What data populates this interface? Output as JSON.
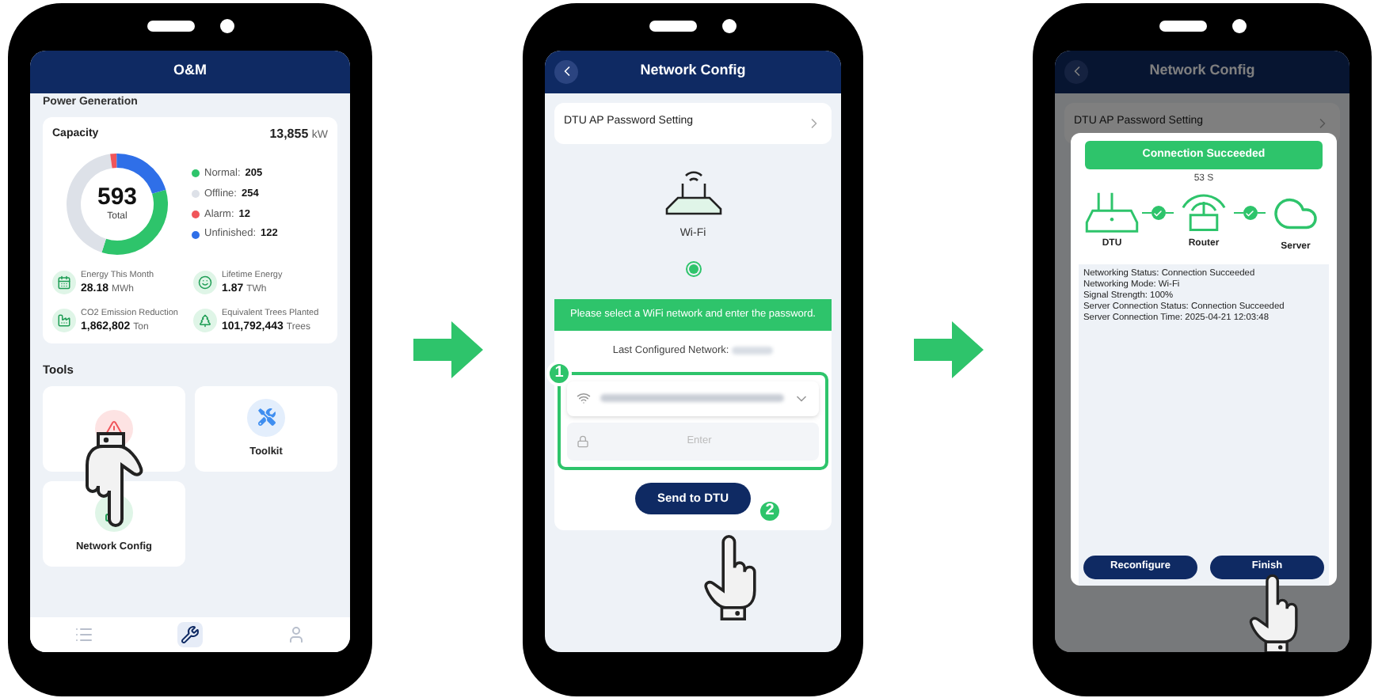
{
  "home_screen": {
    "header": {
      "title": "O&M"
    },
    "section_title": "Power Generation",
    "capacity": {
      "label": "Capacity",
      "value": "13,855",
      "unit": "kW"
    },
    "total": {
      "value": "593",
      "label": "Total"
    },
    "legend": [
      {
        "label": "Normal:",
        "value": "205",
        "color": "#2ec46b"
      },
      {
        "label": "Offline:",
        "value": "254",
        "color": "#dde1e8"
      },
      {
        "label": "Alarm:",
        "value": "12",
        "color": "#f0555a"
      },
      {
        "label": "Unfinished:",
        "value": "122",
        "color": "#2f6fe8"
      }
    ],
    "stats": [
      {
        "kind": "calendar",
        "label": "Energy This Month",
        "value": "28.18",
        "unit": "MWh"
      },
      {
        "kind": "energy",
        "label": "Lifetime Energy",
        "value": "1.87",
        "unit": "TWh"
      },
      {
        "kind": "factory",
        "label": "CO2 Emission Reduction",
        "value": "1,862,802",
        "unit": "Ton"
      },
      {
        "kind": "tree",
        "label": "Equivalent Trees Planted",
        "value": "101,792,443",
        "unit": "Trees"
      }
    ],
    "tools_title": "Tools",
    "tools": [
      {
        "kind": "alarm"
      },
      {
        "kind": "toolkit",
        "label": "Toolkit"
      },
      {
        "kind": "network",
        "label": "Network Config"
      }
    ],
    "nav": [
      {
        "kind": "list",
        "selected": false
      },
      {
        "kind": "wrench",
        "selected": true
      },
      {
        "kind": "person",
        "selected": false
      }
    ]
  },
  "network_screen": {
    "header": {
      "title": "Network Config"
    },
    "ap_setting": "DTU AP Password Setting",
    "device_label": "Wi-Fi",
    "device_selected": true,
    "banner": "Please select a WiFi network and enter the password.",
    "last_network_label": "Last Configured Network:",
    "password_placeholder": "Enter",
    "field_badge": "1",
    "send_button": "Send to DTU",
    "button_badge": "2"
  },
  "result_screen": {
    "header": {
      "title": "Network Config"
    },
    "ap_setting": "DTU AP Password Setting",
    "status_banner": "Connection Succeeded",
    "timer": "53 S",
    "nodes": [
      {
        "kind": "dtu",
        "label": "DTU"
      },
      {
        "kind": "router",
        "label": "Router"
      },
      {
        "kind": "server",
        "label": "Server"
      }
    ],
    "links": [
      {
        "connected": true
      },
      {
        "connected": true
      }
    ],
    "details": [
      "Networking Status: Connection Succeeded",
      "Networking Mode: Wi-Fi",
      "Signal Strength: 100%",
      "Server Connection Status: Connection Succeeded",
      "Server Connection Time: 2025-04-21 12:03:48"
    ],
    "buttons": [
      "Reconfigure",
      "Finish"
    ]
  }
}
